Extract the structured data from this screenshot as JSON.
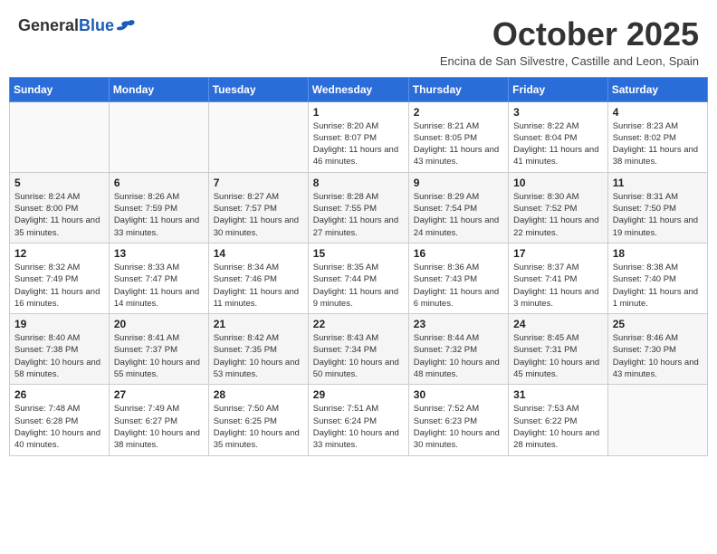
{
  "logo": {
    "general": "General",
    "blue": "Blue"
  },
  "title": "October 2025",
  "subtitle": "Encina de San Silvestre, Castille and Leon, Spain",
  "days_of_week": [
    "Sunday",
    "Monday",
    "Tuesday",
    "Wednesday",
    "Thursday",
    "Friday",
    "Saturday"
  ],
  "weeks": [
    [
      {
        "day": "",
        "info": ""
      },
      {
        "day": "",
        "info": ""
      },
      {
        "day": "",
        "info": ""
      },
      {
        "day": "1",
        "info": "Sunrise: 8:20 AM\nSunset: 8:07 PM\nDaylight: 11 hours and 46 minutes."
      },
      {
        "day": "2",
        "info": "Sunrise: 8:21 AM\nSunset: 8:05 PM\nDaylight: 11 hours and 43 minutes."
      },
      {
        "day": "3",
        "info": "Sunrise: 8:22 AM\nSunset: 8:04 PM\nDaylight: 11 hours and 41 minutes."
      },
      {
        "day": "4",
        "info": "Sunrise: 8:23 AM\nSunset: 8:02 PM\nDaylight: 11 hours and 38 minutes."
      }
    ],
    [
      {
        "day": "5",
        "info": "Sunrise: 8:24 AM\nSunset: 8:00 PM\nDaylight: 11 hours and 35 minutes."
      },
      {
        "day": "6",
        "info": "Sunrise: 8:26 AM\nSunset: 7:59 PM\nDaylight: 11 hours and 33 minutes."
      },
      {
        "day": "7",
        "info": "Sunrise: 8:27 AM\nSunset: 7:57 PM\nDaylight: 11 hours and 30 minutes."
      },
      {
        "day": "8",
        "info": "Sunrise: 8:28 AM\nSunset: 7:55 PM\nDaylight: 11 hours and 27 minutes."
      },
      {
        "day": "9",
        "info": "Sunrise: 8:29 AM\nSunset: 7:54 PM\nDaylight: 11 hours and 24 minutes."
      },
      {
        "day": "10",
        "info": "Sunrise: 8:30 AM\nSunset: 7:52 PM\nDaylight: 11 hours and 22 minutes."
      },
      {
        "day": "11",
        "info": "Sunrise: 8:31 AM\nSunset: 7:50 PM\nDaylight: 11 hours and 19 minutes."
      }
    ],
    [
      {
        "day": "12",
        "info": "Sunrise: 8:32 AM\nSunset: 7:49 PM\nDaylight: 11 hours and 16 minutes."
      },
      {
        "day": "13",
        "info": "Sunrise: 8:33 AM\nSunset: 7:47 PM\nDaylight: 11 hours and 14 minutes."
      },
      {
        "day": "14",
        "info": "Sunrise: 8:34 AM\nSunset: 7:46 PM\nDaylight: 11 hours and 11 minutes."
      },
      {
        "day": "15",
        "info": "Sunrise: 8:35 AM\nSunset: 7:44 PM\nDaylight: 11 hours and 9 minutes."
      },
      {
        "day": "16",
        "info": "Sunrise: 8:36 AM\nSunset: 7:43 PM\nDaylight: 11 hours and 6 minutes."
      },
      {
        "day": "17",
        "info": "Sunrise: 8:37 AM\nSunset: 7:41 PM\nDaylight: 11 hours and 3 minutes."
      },
      {
        "day": "18",
        "info": "Sunrise: 8:38 AM\nSunset: 7:40 PM\nDaylight: 11 hours and 1 minute."
      }
    ],
    [
      {
        "day": "19",
        "info": "Sunrise: 8:40 AM\nSunset: 7:38 PM\nDaylight: 10 hours and 58 minutes."
      },
      {
        "day": "20",
        "info": "Sunrise: 8:41 AM\nSunset: 7:37 PM\nDaylight: 10 hours and 55 minutes."
      },
      {
        "day": "21",
        "info": "Sunrise: 8:42 AM\nSunset: 7:35 PM\nDaylight: 10 hours and 53 minutes."
      },
      {
        "day": "22",
        "info": "Sunrise: 8:43 AM\nSunset: 7:34 PM\nDaylight: 10 hours and 50 minutes."
      },
      {
        "day": "23",
        "info": "Sunrise: 8:44 AM\nSunset: 7:32 PM\nDaylight: 10 hours and 48 minutes."
      },
      {
        "day": "24",
        "info": "Sunrise: 8:45 AM\nSunset: 7:31 PM\nDaylight: 10 hours and 45 minutes."
      },
      {
        "day": "25",
        "info": "Sunrise: 8:46 AM\nSunset: 7:30 PM\nDaylight: 10 hours and 43 minutes."
      }
    ],
    [
      {
        "day": "26",
        "info": "Sunrise: 7:48 AM\nSunset: 6:28 PM\nDaylight: 10 hours and 40 minutes."
      },
      {
        "day": "27",
        "info": "Sunrise: 7:49 AM\nSunset: 6:27 PM\nDaylight: 10 hours and 38 minutes."
      },
      {
        "day": "28",
        "info": "Sunrise: 7:50 AM\nSunset: 6:25 PM\nDaylight: 10 hours and 35 minutes."
      },
      {
        "day": "29",
        "info": "Sunrise: 7:51 AM\nSunset: 6:24 PM\nDaylight: 10 hours and 33 minutes."
      },
      {
        "day": "30",
        "info": "Sunrise: 7:52 AM\nSunset: 6:23 PM\nDaylight: 10 hours and 30 minutes."
      },
      {
        "day": "31",
        "info": "Sunrise: 7:53 AM\nSunset: 6:22 PM\nDaylight: 10 hours and 28 minutes."
      },
      {
        "day": "",
        "info": ""
      }
    ]
  ]
}
